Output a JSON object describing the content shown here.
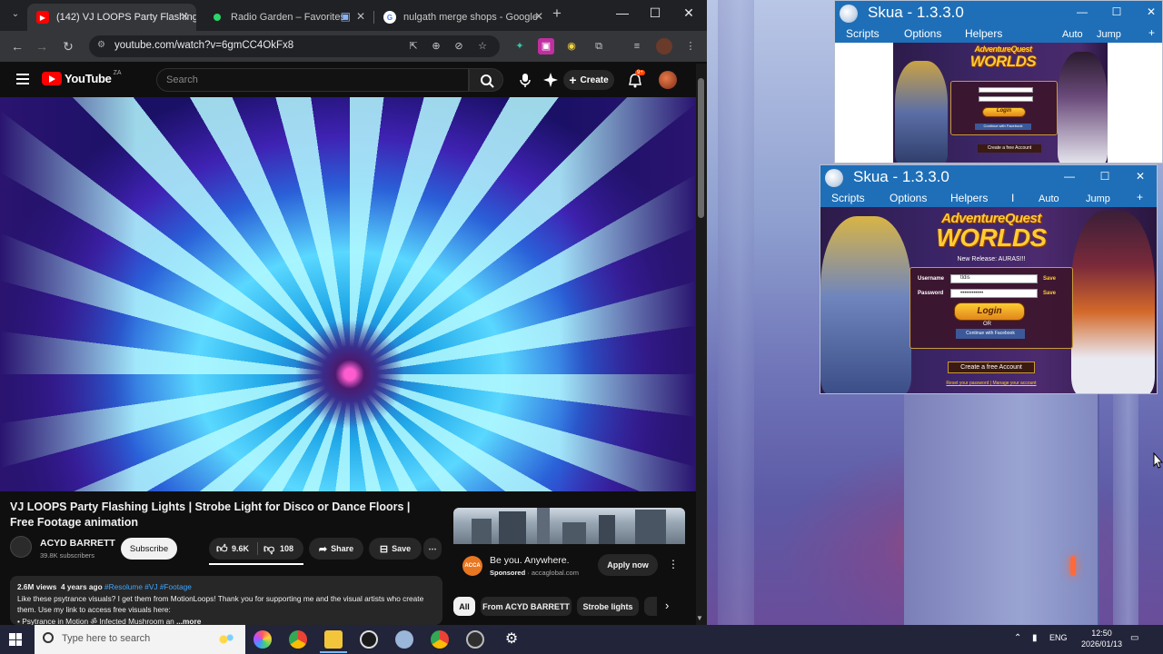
{
  "browser": {
    "tabs": [
      {
        "label": "(142) VJ LOOPS Party Flashing L",
        "favicon": "youtube-icon",
        "active": true
      },
      {
        "label": "Radio Garden – Favorites",
        "favicon": "radio-garden-icon",
        "active": false
      },
      {
        "label": "nulgath merge shops - Google",
        "favicon": "google-icon",
        "active": false
      }
    ],
    "url": "youtube.com/watch?v=6gmCC4OkFx8",
    "window_controls": {
      "minimize": "—",
      "maximize": "☐",
      "close": "✕"
    }
  },
  "youtube": {
    "logo_text": "YouTube",
    "country_code": "ZA",
    "search_placeholder": "Search",
    "create_label": "Create",
    "notification_count": "9+",
    "video_title": "VJ LOOPS Party Flashing Lights | Strobe Light for Disco or Dance Floors | Free Footage animation",
    "channel_name": "ACYD BARRETT",
    "channel_subs": "39.8K subscribers",
    "subscribe_label": "Subscribe",
    "like_count": "9.6K",
    "dislike_count": "108",
    "share_label": "Share",
    "save_label": "Save",
    "description": {
      "views": "2.6M views",
      "age": "4 years ago",
      "tags": "#Resolume #VJ #Footage",
      "text": "Like these psytrance visuals? I get them from MotionLoops! Thank you for supporting me and the visual artists who create them. Use my link to access free visuals here:",
      "line3": "• Psytrance in Motion ॐ Infected Mushroom an",
      "more": "...more"
    },
    "ad": {
      "title": "Be you. Anywhere.",
      "sponsored": "Sponsored",
      "domain": "· accaglobal.com",
      "apply_label": "Apply now",
      "logo_text": "ACCA"
    },
    "chips": [
      "All",
      "From ACYD BARRETT",
      "Strobe lights"
    ]
  },
  "skua_windows": [
    {
      "title": "Skua - 1.3.3.0",
      "menu": [
        "Scripts",
        "Options",
        "Helpers"
      ],
      "right_menu": [
        "Auto",
        "Jump",
        "+"
      ]
    },
    {
      "title": "Skua - 1.3.3.0",
      "menu": [
        "Scripts",
        "Options",
        "Helpers",
        "I"
      ],
      "right_menu": [
        "Auto",
        "Jump",
        "+"
      ]
    }
  ],
  "game": {
    "logo_line1": "AdventureQuest",
    "logo_line2": "WORLDS",
    "release": "New Release: AURAS!!!",
    "username_label": "Username",
    "username_value": "tldis",
    "password_label": "Password",
    "password_value": "••••••••••••",
    "save_label": "Save",
    "login_label": "Login",
    "or_label": "OR",
    "facebook_label": "Continue with Facebook",
    "create_account_label": "Create a free Account",
    "footer_links": "Reset your password  |  Manage your account"
  },
  "taskbar": {
    "search_placeholder": "Type here to search",
    "language": "ENG",
    "time": "12:50",
    "date": "2026/01/13"
  }
}
